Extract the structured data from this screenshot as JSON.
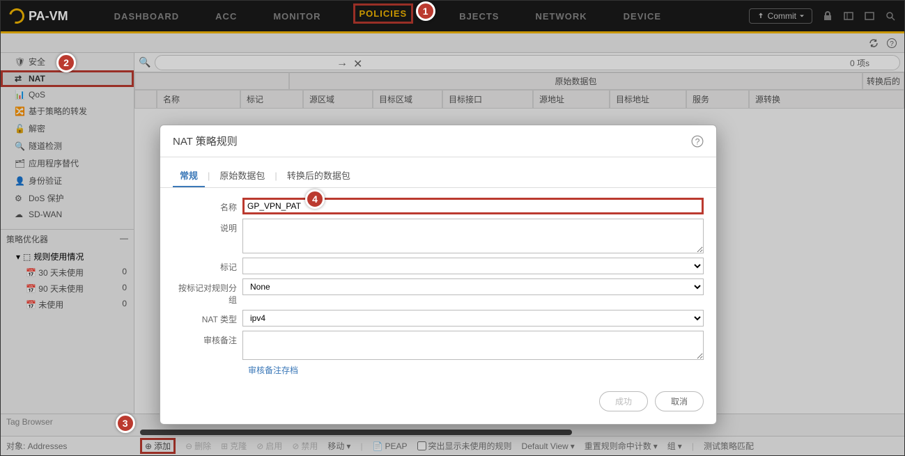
{
  "brand": "PA-VM",
  "nav": {
    "dashboard": "DASHBOARD",
    "acc": "ACC",
    "monitor": "MONITOR",
    "policies": "POLICIES",
    "objects": "BJECTS",
    "network": "NETWORK",
    "device": "DEVICE"
  },
  "commit": "Commit",
  "callouts": {
    "c1": "1",
    "c2": "2",
    "c3": "3",
    "c4": "4"
  },
  "sidebar": {
    "items": [
      {
        "label": "安全"
      },
      {
        "label": "NAT"
      },
      {
        "label": "QoS"
      },
      {
        "label": "基于策略的转发"
      },
      {
        "label": "解密"
      },
      {
        "label": "隧道检测"
      },
      {
        "label": "应用程序替代"
      },
      {
        "label": "身份验证"
      },
      {
        "label": "DoS 保护"
      },
      {
        "label": "SD-WAN"
      }
    ],
    "optimizer": "策略优化器",
    "usage": "规则使用情况",
    "u30": "30 天未使用",
    "u30c": "0",
    "u90": "90 天未使用",
    "u90c": "0",
    "unused": "未使用",
    "unusedc": "0"
  },
  "search": {
    "items": "0 项s"
  },
  "table": {
    "grp_original": "原始数据包",
    "grp_translated": "转换后的",
    "name": "名称",
    "tag": "标记",
    "srczone": "源区域",
    "dstzone": "目标区域",
    "dstif": "目标接口",
    "srcaddr": "源地址",
    "dstaddr": "目标地址",
    "service": "服务",
    "srctrans": "源转换"
  },
  "modal": {
    "title": "NAT 策略规则",
    "tab_general": "常规",
    "tab_orig": "原始数据包",
    "tab_trans": "转换后的数据包",
    "lbl_name": "名称",
    "val_name": "GP_VPN_PAT",
    "lbl_desc": "说明",
    "lbl_tag": "标记",
    "lbl_group": "按标记对规则分组",
    "val_group": "None",
    "lbl_nattype": "NAT 类型",
    "val_nattype": "ipv4",
    "lbl_audit": "审核备注",
    "archive": "审核备注存档",
    "ok": "成功",
    "cancel": "取消"
  },
  "tagbrowser": "Tag Browser",
  "status": {
    "target": "对象: Addresses",
    "add": "添加",
    "delete": "删除",
    "clone": "克隆",
    "enable": "启用",
    "disable": "禁用",
    "move": "移动",
    "peap": "PEAP",
    "highlight": "突出显示未使用的规则",
    "view": "Default View",
    "reset": "重置规则命中计数",
    "group": "组",
    "test": "测试策略匹配"
  }
}
